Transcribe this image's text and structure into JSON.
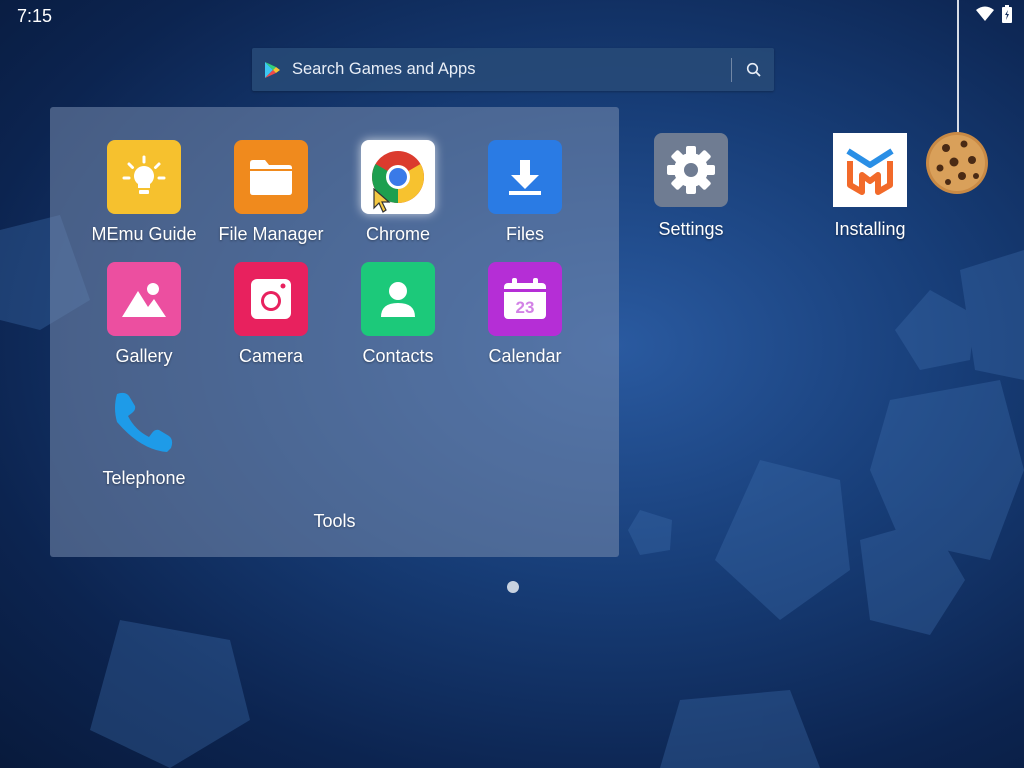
{
  "status_bar": {
    "time": "7:15"
  },
  "search": {
    "placeholder": "Search Games and Apps"
  },
  "folder": {
    "name": "Tools",
    "apps": [
      {
        "label": "MEmu Guide",
        "icon": "lightbulb-icon",
        "color": "#f6c12e"
      },
      {
        "label": "File Manager",
        "icon": "folder-icon",
        "color": "#f08a1d"
      },
      {
        "label": "Chrome",
        "icon": "chrome-icon",
        "color": "#ffffff"
      },
      {
        "label": "Files",
        "icon": "download-icon",
        "color": "#2a7be4"
      },
      {
        "label": "Gallery",
        "icon": "gallery-icon",
        "color": "#ec4fa0"
      },
      {
        "label": "Camera",
        "icon": "camera-icon",
        "color": "#e8215e"
      },
      {
        "label": "Contacts",
        "icon": "contacts-icon",
        "color": "#1cc97a"
      },
      {
        "label": "Calendar",
        "icon": "calendar-icon",
        "color": "#b52ed6"
      },
      {
        "label": "Telephone",
        "icon": "phone-icon",
        "color": "#1e9be8"
      }
    ]
  },
  "desktop": {
    "apps": [
      {
        "label": "Settings",
        "icon": "gear-icon",
        "color": "#6f7c92"
      },
      {
        "label": "Installing",
        "icon": "memu-logo-icon",
        "color": "#ffffff"
      }
    ]
  },
  "pager": {
    "pages": 1,
    "current": 1
  }
}
